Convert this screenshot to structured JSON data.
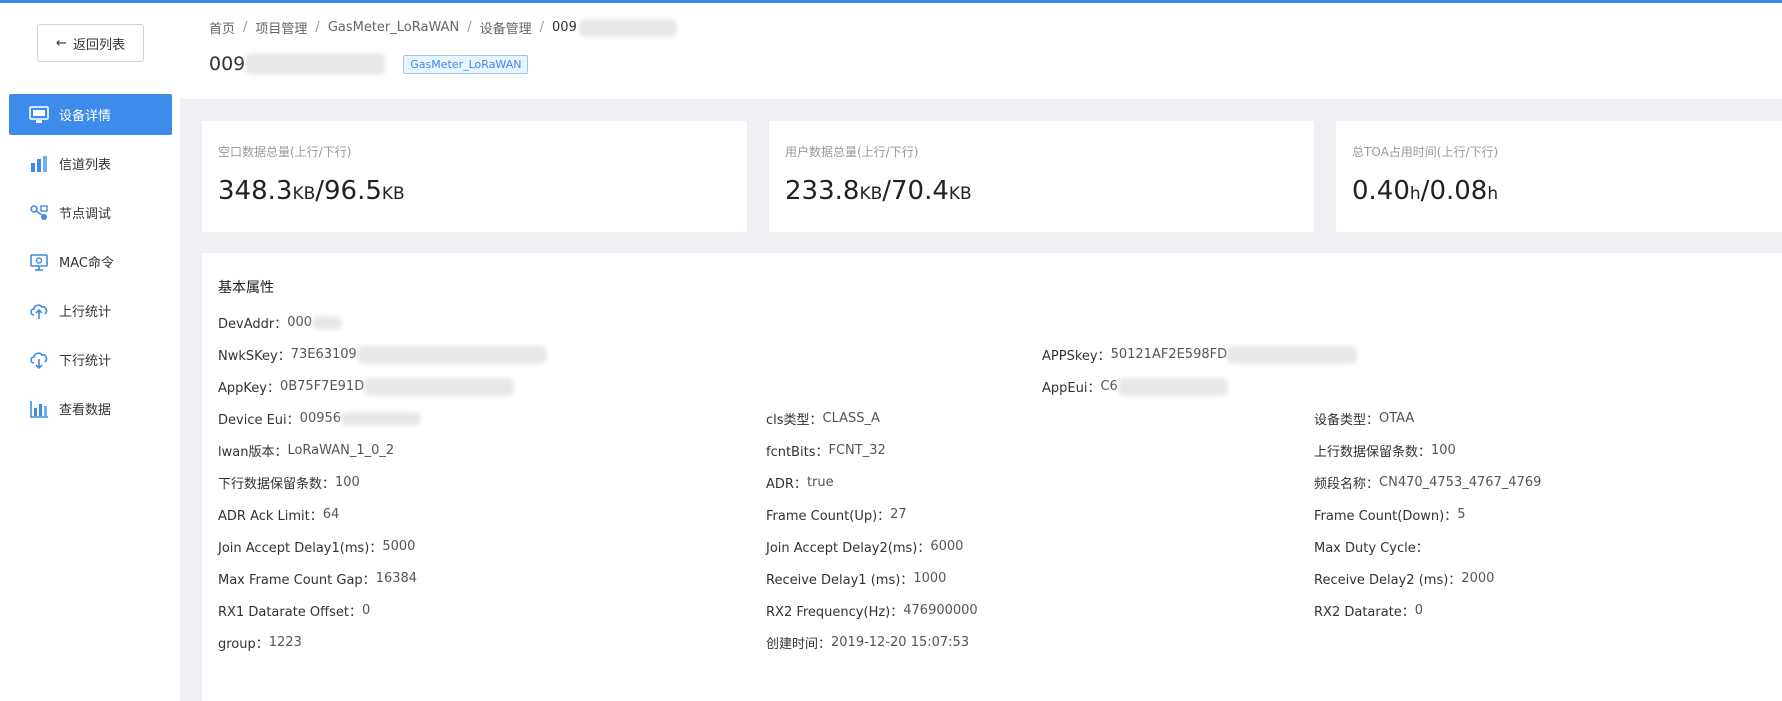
{
  "back": {
    "label": "返回列表"
  },
  "menu": [
    {
      "label": "设备详情",
      "icon": "monitor-icon"
    },
    {
      "label": "信道列表",
      "icon": "bar-chart-icon"
    },
    {
      "label": "节点调试",
      "icon": "node-debug-icon"
    },
    {
      "label": "MAC命令",
      "icon": "mac-command-icon"
    },
    {
      "label": "上行统计",
      "icon": "cloud-upload-icon"
    },
    {
      "label": "下行统计",
      "icon": "cloud-download-icon"
    },
    {
      "label": "查看数据",
      "icon": "data-chart-icon"
    }
  ],
  "breadcrumb": [
    "首页",
    "项目管理",
    "GasMeter_LoRaWAN",
    "设备管理",
    "009"
  ],
  "device": {
    "name_prefix": "009",
    "tag": "GasMeter_LoRaWAN"
  },
  "stats": [
    {
      "label": "空口数据总量(上行/下行)",
      "up": "348.3",
      "up_unit": "KB",
      "sep": "/",
      "down": "96.5",
      "down_unit": "KB"
    },
    {
      "label": "用户数据总量(上行/下行)",
      "up": "233.8",
      "up_unit": "KB",
      "sep": "/",
      "down": "70.4",
      "down_unit": "KB"
    },
    {
      "label": "总TOA占用时间(上行/下行)",
      "up": "0.40",
      "up_unit": "h",
      "sep": "/",
      "down": "0.08",
      "down_unit": "h"
    }
  ],
  "props_title": "基本属性",
  "props": {
    "devaddr": {
      "k": "DevAddr：",
      "v": "000"
    },
    "nwkskey": {
      "k": "NwkSKey：",
      "v": "73E63109"
    },
    "appskey": {
      "k": "APPSkey：",
      "v": "50121AF2E598FD"
    },
    "appkey": {
      "k": "AppKey：",
      "v": "0B75F7E91D"
    },
    "appeui": {
      "k": "AppEui：",
      "v": "C6"
    },
    "device_eui": {
      "k": "Device Eui：",
      "v": "00956"
    },
    "cls": {
      "k": "cls类型：",
      "v": "CLASS_A"
    },
    "device_type": {
      "k": "设备类型：",
      "v": "OTAA"
    },
    "lwan": {
      "k": "lwan版本：",
      "v": "LoRaWAN_1_0_2"
    },
    "fcnt": {
      "k": "fcntBits：",
      "v": "FCNT_32"
    },
    "up_keep": {
      "k": "上行数据保留条数：",
      "v": "100"
    },
    "down_keep": {
      "k": "下行数据保留条数：",
      "v": "100"
    },
    "adr": {
      "k": "ADR：",
      "v": "true"
    },
    "band": {
      "k": "频段名称：",
      "v": "CN470_4753_4767_4769"
    },
    "adr_ack": {
      "k": "ADR Ack Limit：",
      "v": "64"
    },
    "frame_up": {
      "k": "Frame Count(Up)：",
      "v": "27"
    },
    "frame_down": {
      "k": "Frame Count(Down)：",
      "v": "5"
    },
    "join1": {
      "k": "Join Accept Delay1(ms)：",
      "v": "5000"
    },
    "join2": {
      "k": "Join Accept Delay2(ms)：",
      "v": "6000"
    },
    "duty": {
      "k": "Max Duty Cycle：",
      "v": ""
    },
    "max_gap": {
      "k": "Max Frame Count Gap：",
      "v": "16384"
    },
    "rx_delay1": {
      "k": "Receive Delay1 (ms)：",
      "v": "1000"
    },
    "rx_delay2": {
      "k": "Receive Delay2 (ms)：",
      "v": "2000"
    },
    "rx1_offset": {
      "k": "RX1 Datarate Offset：",
      "v": "0"
    },
    "rx2_freq": {
      "k": "RX2 Frequency(Hz)：",
      "v": "476900000"
    },
    "rx2_dr": {
      "k": "RX2 Datarate：",
      "v": "0"
    },
    "group": {
      "k": "group：",
      "v": "1223"
    },
    "created": {
      "k": "创建时间：",
      "v": "2019-12-20 15:07:53"
    }
  }
}
